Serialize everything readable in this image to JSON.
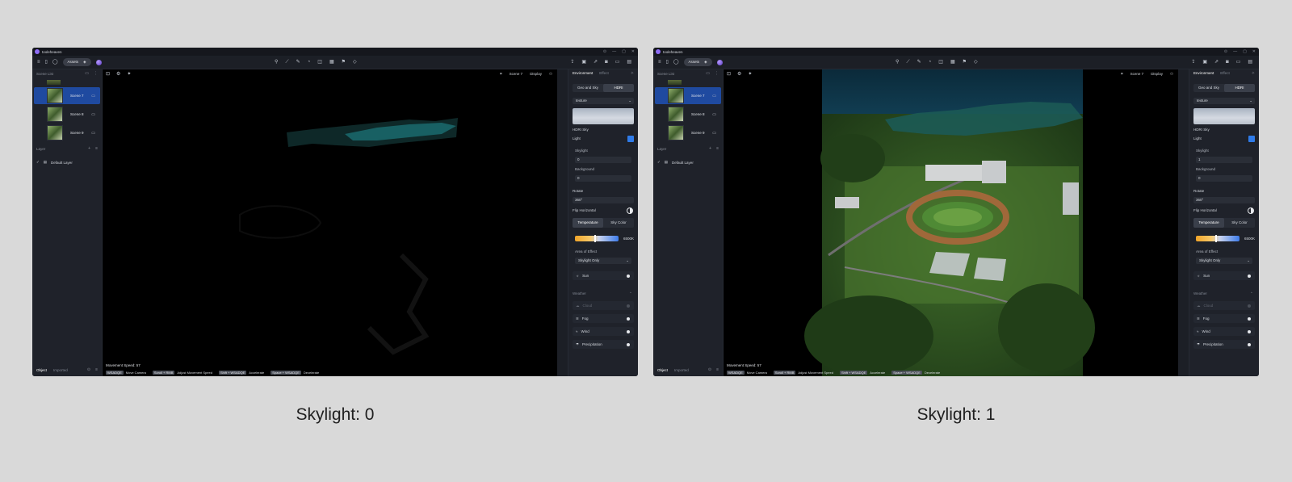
{
  "screens": [
    {
      "id": "left",
      "caption": "Skylight: 0",
      "skylight_value": "0",
      "scene_brightness": 0.0
    },
    {
      "id": "right",
      "caption": "Skylight: 1",
      "skylight_value": "1",
      "scene_brightness": 1.0
    }
  ],
  "app": {
    "name": "tooleheaven"
  },
  "window_controls": [
    "⊙",
    "—",
    "▢",
    "✕"
  ],
  "toolbar": {
    "assets_label": "Assets",
    "center_icons": [
      "pin-icon",
      "measure-icon",
      "brush-icon",
      "sphere-icon",
      "box-icon",
      "grid-icon",
      "flag-icon",
      "layers-icon"
    ],
    "right_icons": [
      "upload-icon",
      "camera-icon",
      "export-icon",
      "photo-icon",
      "video-icon",
      "save-icon"
    ]
  },
  "sidebar": {
    "scene_list_label": "Scene List",
    "scenes": [
      {
        "label": "Scene 7",
        "selected": true
      },
      {
        "label": "Scene 8",
        "selected": false
      },
      {
        "label": "Scene 9",
        "selected": false
      }
    ],
    "layer_label": "Layer",
    "default_layer": "Default Layer",
    "footer_tabs": [
      "Object",
      "Imported"
    ]
  },
  "viewport": {
    "scene_label": "Scene 7",
    "display_label": "Display",
    "movement_speed": "Movement Speed: 57",
    "hints": [
      {
        "key": "WSADQE",
        "text": "Move Camera"
      },
      {
        "key": "Scroll + RMB",
        "text": "Adjust Movement Speed"
      },
      {
        "key": "Shift + WSADQE",
        "text": "Accelerate"
      },
      {
        "key": "Space + WSADQE",
        "text": "Decelerate"
      }
    ]
  },
  "panel": {
    "tabs": [
      "Environment",
      "Effect"
    ],
    "sky_mode": [
      "Geo and Sky",
      "HDRI"
    ],
    "texture_label": "texture",
    "hdri_sky_label": "HDRI Sky",
    "light_label": "Light",
    "skylight_label": "Skylight",
    "background_label": "Background",
    "background_value": "0",
    "rotate_label": "Rotate",
    "rotate_value": "360°",
    "flip_horizontal_label": "Flip Horizontal",
    "color_mode": [
      "Temperature",
      "Sky Color"
    ],
    "temperature_value": "6500K",
    "temperature_fraction": 0.45,
    "area_of_effect_label": "Area of Effect",
    "area_of_effect_value": "Skylight Only",
    "sun_label": "Sun",
    "weather_label": "Weather",
    "weather_items": [
      {
        "label": "Cloud",
        "enabled": false
      },
      {
        "label": "Fog",
        "enabled": true
      },
      {
        "label": "Wind",
        "enabled": true
      },
      {
        "label": "Precipitation",
        "enabled": true
      }
    ]
  }
}
